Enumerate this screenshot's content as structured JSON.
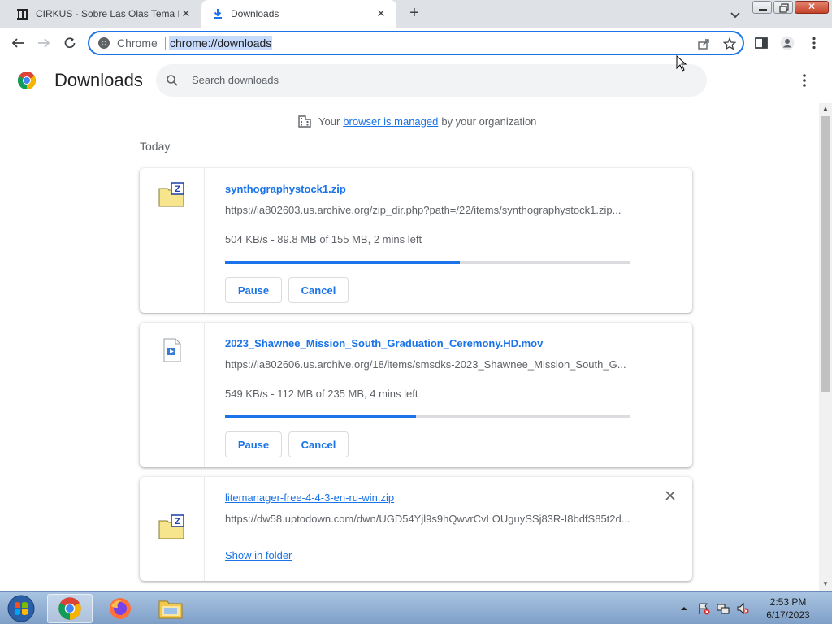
{
  "tabs": [
    {
      "title": "CIRKUS - Sobre Las Olas Tema De",
      "favicon": "archive-icon",
      "active": false
    },
    {
      "title": "Downloads",
      "favicon": "download-icon",
      "active": true
    }
  ],
  "omnibox": {
    "site_label": "Chrome",
    "url": "chrome://downloads"
  },
  "page": {
    "title": "Downloads",
    "search_placeholder": "Search downloads",
    "managed_prefix": "Your",
    "managed_link": "browser is managed",
    "managed_suffix": "by your organization",
    "section_label": "Today"
  },
  "downloads": [
    {
      "filename": "synthographystock1.zip",
      "url": "https://ia802603.us.archive.org/zip_dir.php?path=/22/items/synthographystock1.zip...",
      "status": "504 KB/s - 89.8 MB of 155 MB, 2 mins left",
      "progress": 0.58,
      "pause_label": "Pause",
      "cancel_label": "Cancel",
      "icon": "zip-file-icon"
    },
    {
      "filename": "2023_Shawnee_Mission_South_Graduation_Ceremony.HD.mov",
      "url": "https://ia802606.us.archive.org/18/items/smsdks-2023_Shawnee_Mission_South_G...",
      "status": "549 KB/s - 112 MB of 235 MB, 4 mins left",
      "progress": 0.47,
      "pause_label": "Pause",
      "cancel_label": "Cancel",
      "icon": "video-file-icon"
    },
    {
      "filename": "litemanager-free-4-4-3-en-ru-win.zip",
      "url": "https://dw58.uptodown.com/dwn/UGD54Yjl9s9hQwvrCvLOUguySSj83R-I8bdfS85t2d...",
      "show_folder_label": "Show in folder",
      "icon": "zip-file-icon"
    }
  ],
  "taskbar": {
    "time": "2:53 PM",
    "date": "6/17/2023"
  },
  "colors": {
    "accent": "#1a73e8",
    "tabstrip": "#dee1e6",
    "progress_track": "#dadce0"
  }
}
